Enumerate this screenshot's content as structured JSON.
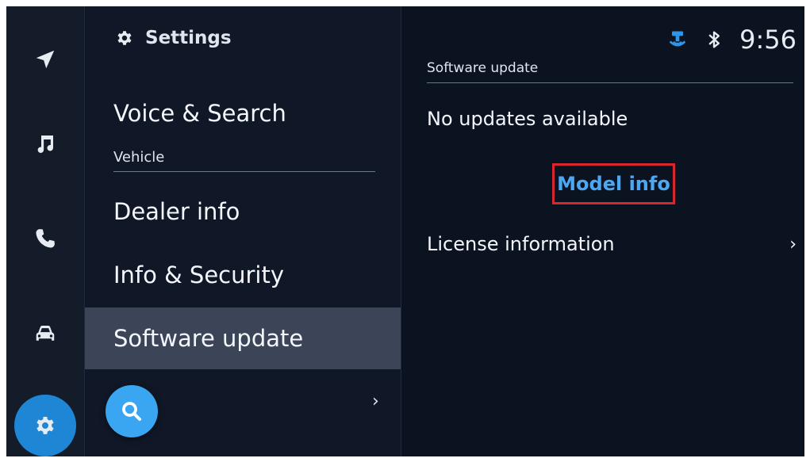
{
  "rail": {
    "items": [
      {
        "icon": "navigation-arrow-icon"
      },
      {
        "icon": "music-note-icon"
      },
      {
        "icon": "phone-icon"
      },
      {
        "icon": "car-icon"
      },
      {
        "icon": "gear-icon",
        "active": true
      }
    ],
    "active_color": "#1f86d6"
  },
  "settings_list": {
    "title": "Settings",
    "items": {
      "voice_search": "Voice & Search",
      "vehicle_section": "Vehicle",
      "dealer_info": "Dealer info",
      "info_security": "Info & Security",
      "software_update": "Software update"
    },
    "selected": "Software update",
    "search_icon": "search-icon",
    "next_chevron": "›"
  },
  "status_bar": {
    "clock": "9:56",
    "icons": [
      "connected-services-icon",
      "bluetooth-icon"
    ]
  },
  "detail": {
    "section_title": "Software update",
    "status_text": "No updates available",
    "model_info_link": "Model info",
    "license_label": "License information",
    "license_chevron": "›",
    "highlight_color": "#d7262d",
    "link_color": "#4aa8f5"
  }
}
